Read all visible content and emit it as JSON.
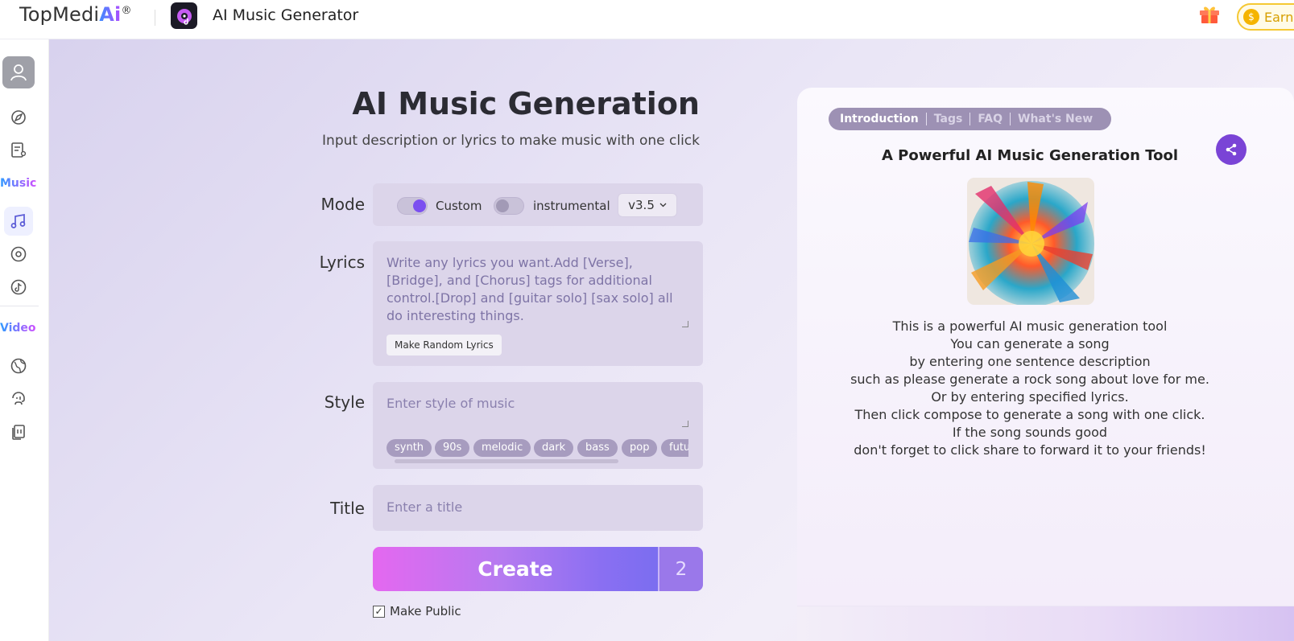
{
  "topbar": {
    "brand_text": "TopMedi",
    "brand_ai": "Ai",
    "brand_reg": "®",
    "app_title": "AI Music Generator",
    "earn_label": "Earn",
    "coin_symbol": "$"
  },
  "sidebar": {
    "music_label": "Music",
    "video_label": "Video",
    "icons": [
      "avatar-icon",
      "compass-icon",
      "document-user-icon",
      "music-note-icon",
      "disc-icon",
      "tiktok-icon",
      "globe-icon",
      "voice-icon",
      "library-icon"
    ]
  },
  "form": {
    "heading": "AI Music Generation",
    "subheading": "Input description or lyrics to make music with one click",
    "mode_label": "Mode",
    "custom_label": "Custom",
    "instrumental_label": "instrumental",
    "version": "v3.5",
    "lyrics_label": "Lyrics",
    "lyrics_placeholder": "Write any lyrics you want.Add [Verse], [Bridge], and [Chorus] tags for additional control.[Drop] and [guitar solo] [sax solo] all do interesting things.",
    "random_lyrics_button": "Make Random Lyrics",
    "style_label": "Style",
    "style_placeholder": "Enter style of music",
    "style_tags": [
      "synth",
      "90s",
      "melodic",
      "dark",
      "bass",
      "pop",
      "futu"
    ],
    "title_label": "Title",
    "title_placeholder": "Enter a title",
    "create_button": "Create",
    "credit_count": "2",
    "make_public_label": "Make Public",
    "make_public_checked": true,
    "custom_on": true,
    "instrumental_on": false
  },
  "info": {
    "tabs": [
      "Introduction",
      "Tags",
      "FAQ",
      "What's New"
    ],
    "active_tab": "Introduction",
    "title": "A Powerful AI Music Generation Tool",
    "lines": [
      "This is a powerful AI music generation tool",
      "You can generate a song",
      "by entering one sentence description",
      "such as please generate a rock song about love for me.",
      "Or by entering specified lyrics.",
      "Then click compose to generate a song with one click.",
      "If the song sounds good",
      "don't forget to click share to forward it to your friends!"
    ]
  },
  "colors": {
    "accent": "#7b4ff0",
    "create_gradient_start": "#e468f0",
    "create_gradient_end": "#7b6ef0",
    "panel_bg": "#dcd5ea",
    "share_button": "#7a44d6"
  }
}
